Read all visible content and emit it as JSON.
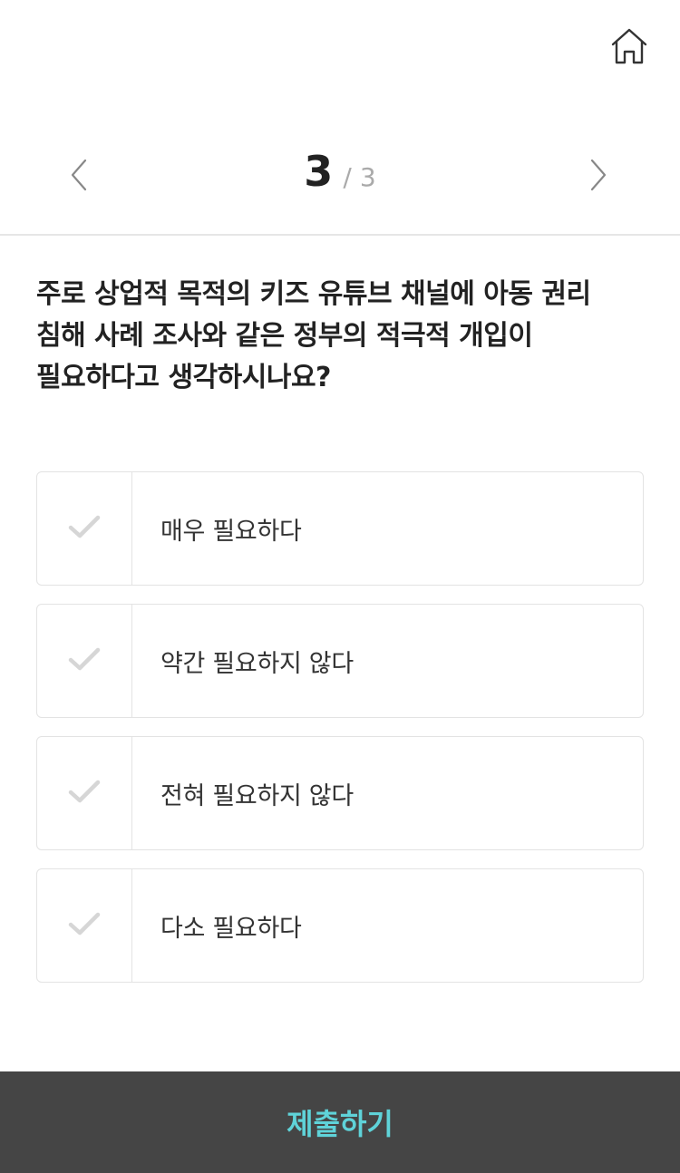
{
  "header": {
    "home_icon": "home-icon"
  },
  "pager": {
    "current": "3",
    "separator": "/",
    "total": "3",
    "prev_icon": "chevron-left-icon",
    "next_icon": "chevron-right-icon"
  },
  "question": {
    "text": "주로 상업적 목적의 키즈 유튜브 채널에 아동 권리 침해 사례 조사와 같은 정부의 적극적 개입이 필요하다고 생각하시나요?"
  },
  "options": [
    {
      "label": "매우 필요하다",
      "icon": "check-icon"
    },
    {
      "label": "약간 필요하지 않다",
      "icon": "check-icon"
    },
    {
      "label": "전혀 필요하지 않다",
      "icon": "check-icon"
    },
    {
      "label": "다소 필요하다",
      "icon": "check-icon"
    }
  ],
  "submit": {
    "label": "제출하기"
  },
  "colors": {
    "submit_bg": "#454545",
    "submit_text": "#5fd3d9",
    "check_inactive": "#d6d6d6",
    "border": "#e3e3e3"
  }
}
